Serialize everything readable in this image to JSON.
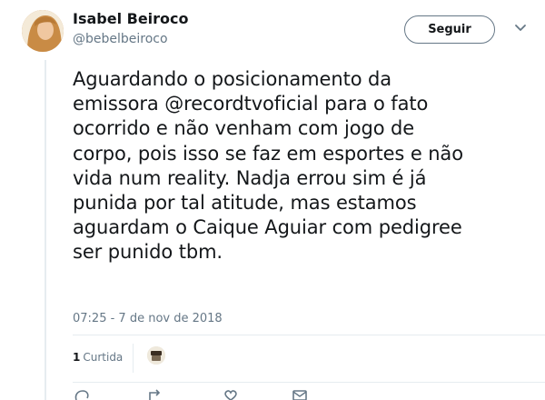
{
  "tweet": {
    "author": {
      "name": "Isabel Beiroco",
      "handle": "@bebelbeiroco"
    },
    "follow_label": "Seguir",
    "text_lines": [
      "Aguardando o posicionamento da",
      "emissora @recordtvoficial para o fato",
      "ocorrido e não venham com jogo de",
      "corpo, pois isso se faz em esportes e não",
      "vida num reality. Nadja errou sim é já",
      "punida por tal atitude, mas estamos",
      "aguardam o Caique Aguiar com pedigree",
      "ser punido tbm."
    ],
    "timestamp": "07:25 - 7 de nov de 2018",
    "stats": {
      "likes_count": "1",
      "likes_label": "Curtida"
    }
  },
  "icons": {
    "caret": "chevron-down-icon",
    "actions": [
      "reply-icon",
      "retweet-icon",
      "like-icon",
      "message-icon"
    ]
  },
  "colors": {
    "text": "#14171a",
    "secondary": "#657786",
    "border": "#e6ecf0"
  }
}
